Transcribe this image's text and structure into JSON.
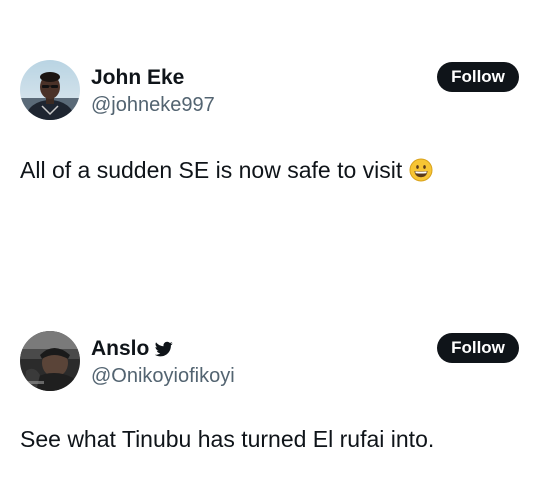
{
  "posts": [
    {
      "display_name": "John Eke",
      "handle": "@johneke997",
      "follow_label": "Follow",
      "text": "All of a sudden SE is now safe to visit",
      "emoji": "grinning-face-icon",
      "verified": false
    },
    {
      "display_name": "Anslo",
      "handle": "@Onikoyiofikoyi",
      "follow_label": "Follow",
      "text": "See what Tinubu has turned El rufai into.",
      "verified": true,
      "verified_icon": "twitter-bird-icon"
    }
  ],
  "colors": {
    "text_primary": "#0f1419",
    "text_secondary": "#536471",
    "button_bg": "#0f1419",
    "button_text": "#ffffff",
    "emoji_yellow": "#f7c534"
  }
}
